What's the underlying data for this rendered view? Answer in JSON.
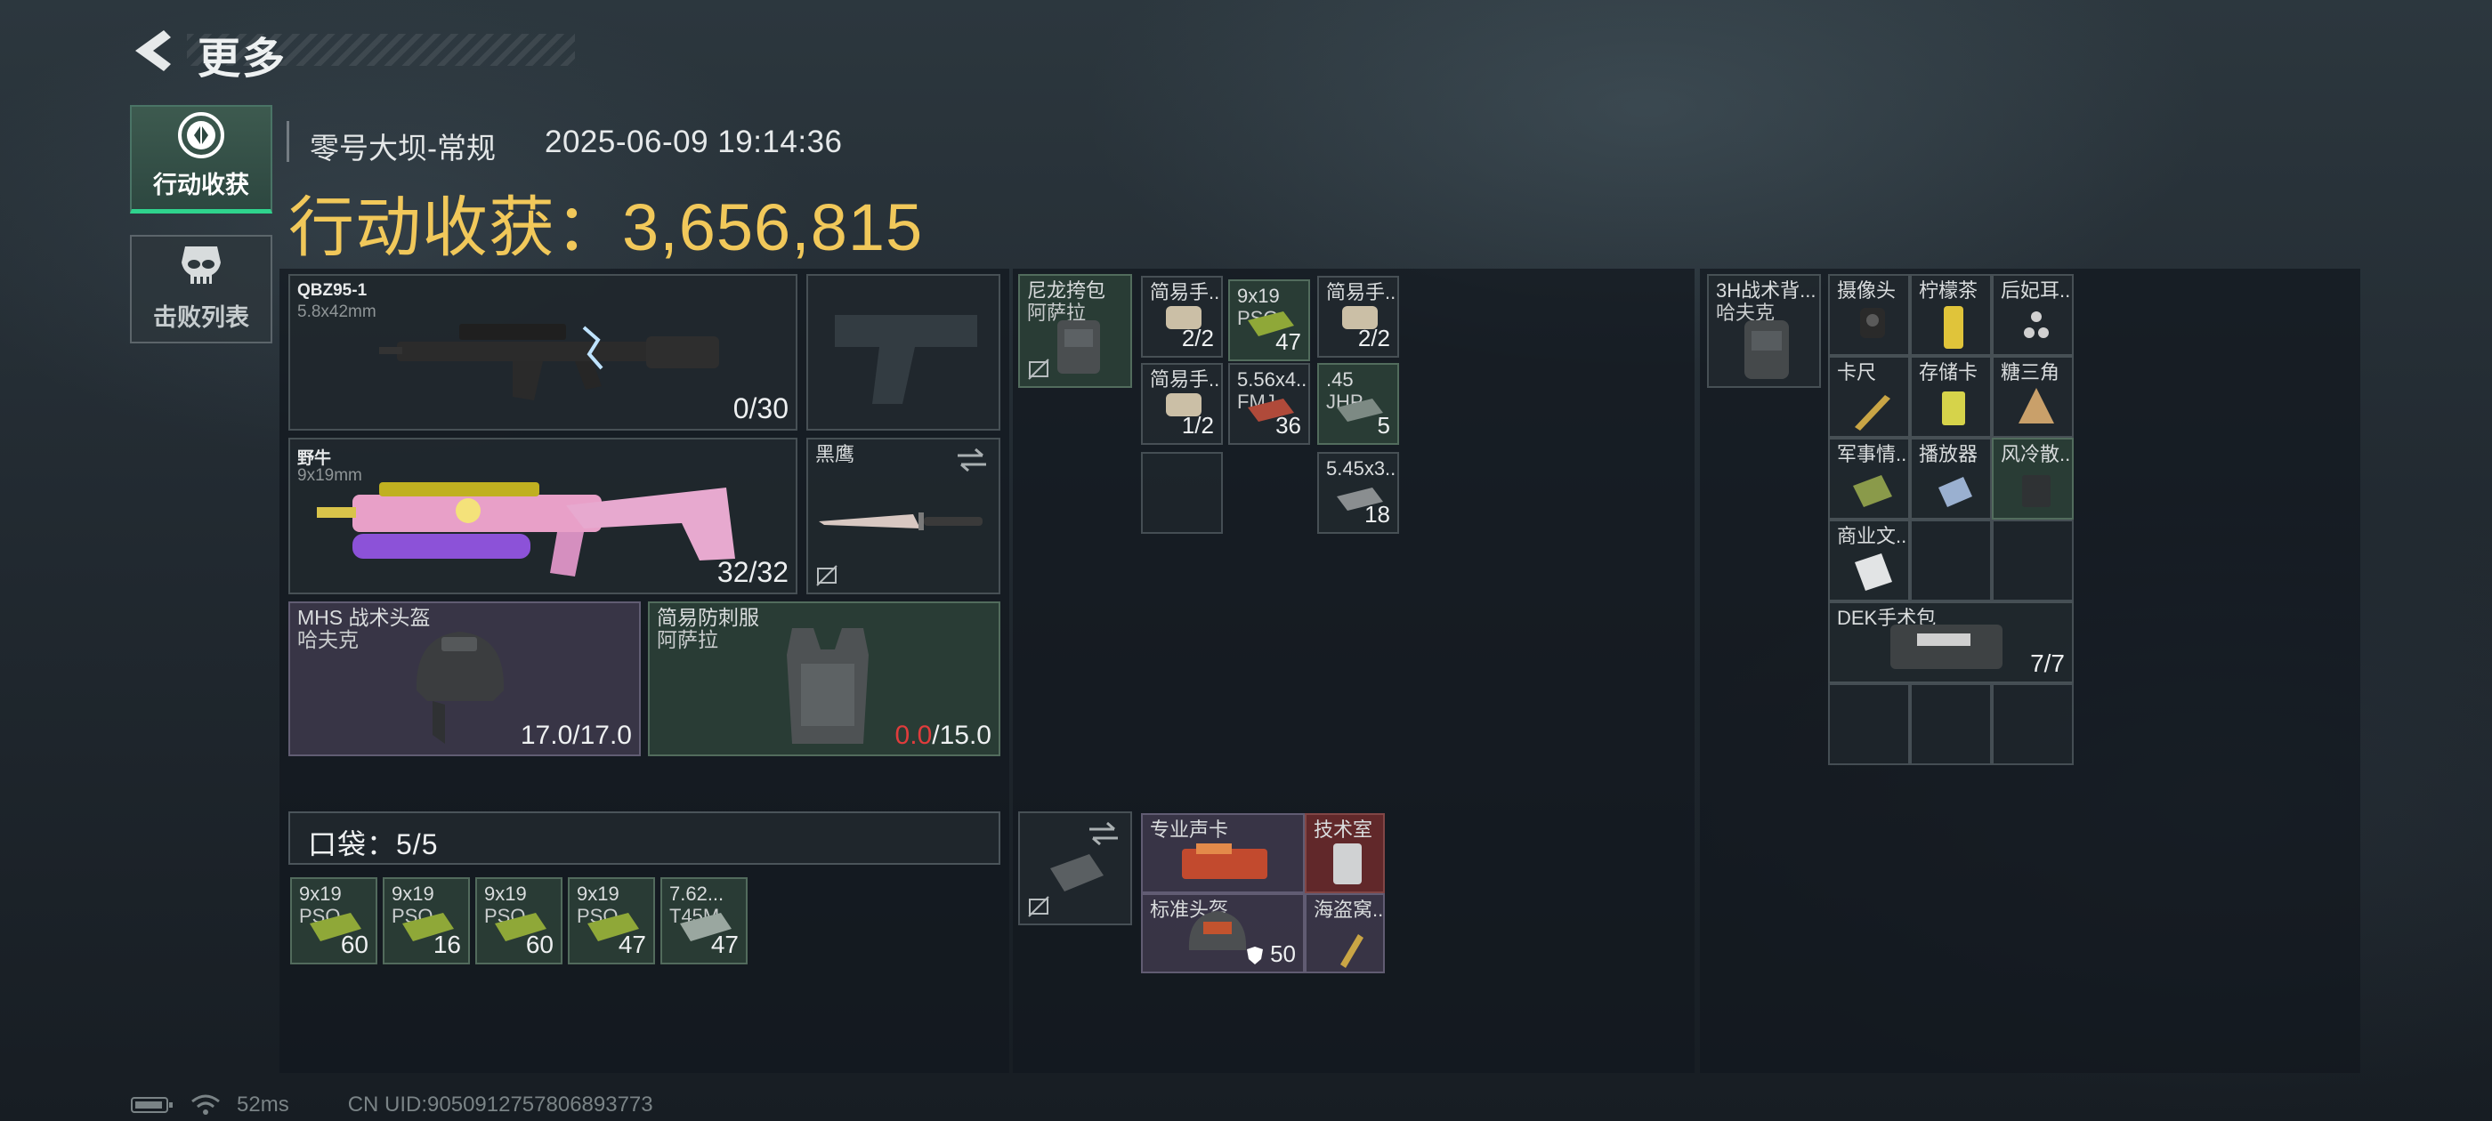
{
  "header": {
    "title": "更多",
    "back_icon": "back-arrow-icon"
  },
  "nav": [
    {
      "label": "行动收获",
      "icon": "loot-emblem-icon",
      "active": true
    },
    {
      "label": "击败列表",
      "icon": "skull-icon",
      "active": false
    }
  ],
  "session": {
    "map": "零号大坝-常规",
    "timestamp": "2025-06-09 19:14:36",
    "earnings_label": "行动收获：",
    "earnings_value": "3,656,815"
  },
  "loadout": {
    "primary": {
      "name": "QBZ95-1",
      "caliber": "5.8x42mm",
      "ammo": "0/30"
    },
    "secondary": {
      "name": "野牛",
      "caliber": "9x19mm",
      "ammo": "32/32"
    },
    "melee": {
      "name": "黑鹰"
    },
    "helmet": {
      "name": "MHS 战术头盔",
      "brand": "哈夫克",
      "durability": "17.0/17.0"
    },
    "armor": {
      "name": "简易防刺服",
      "brand": "阿萨拉",
      "durability_current": "0.0",
      "durability_max": "/15.0"
    }
  },
  "pocket": {
    "label": "口袋：5/5",
    "items": [
      {
        "name": "9x19",
        "sub": "PSO",
        "count": "60"
      },
      {
        "name": "9x19",
        "sub": "PSO",
        "count": "16"
      },
      {
        "name": "9x19",
        "sub": "PSO",
        "count": "60"
      },
      {
        "name": "9x19",
        "sub": "PSO",
        "count": "47"
      },
      {
        "name": "7.62...",
        "sub": "T45M",
        "count": "47"
      }
    ]
  },
  "chest_rig": {
    "name": "尼龙挎包",
    "brand": "阿萨拉",
    "items": [
      {
        "name": "简易手...",
        "count": "2/2"
      },
      {
        "name": "9x19",
        "sub": "PSO",
        "count": "47"
      },
      {
        "name": "简易手...",
        "count": "2/2"
      },
      {
        "name": "简易手...",
        "count": "1/2"
      },
      {
        "name": "5.56x4...",
        "sub": "FMJ",
        "count": "36"
      },
      {
        "name": ".45",
        "sub": "JHP",
        "count": "5"
      },
      {
        "name": "5.45x3...",
        "count": "18"
      }
    ]
  },
  "safe_box": {
    "items": [
      {
        "name": "专业声卡"
      },
      {
        "name": "技术室"
      },
      {
        "name": "标准头盔",
        "count": "50"
      },
      {
        "name": "海盗窝..."
      }
    ]
  },
  "backpack": {
    "name": "3H战术背...",
    "brand": "哈夫克",
    "items": [
      {
        "name": "摄像头"
      },
      {
        "name": "柠檬茶"
      },
      {
        "name": "后妃耳..."
      },
      {
        "name": "卡尺"
      },
      {
        "name": "存储卡"
      },
      {
        "name": "糖三角"
      },
      {
        "name": "军事情..."
      },
      {
        "name": "播放器"
      },
      {
        "name": "风冷散..."
      },
      {
        "name": "商业文..."
      },
      {
        "name": "DEK手术包",
        "count": "7/7"
      }
    ]
  },
  "status_bar": {
    "ping": "52ms",
    "uid": "CN UID:9050912757806893773"
  },
  "colors": {
    "accent": "#2fd38d",
    "earnings": "#f1c85a",
    "warning": "#e03c3c"
  }
}
